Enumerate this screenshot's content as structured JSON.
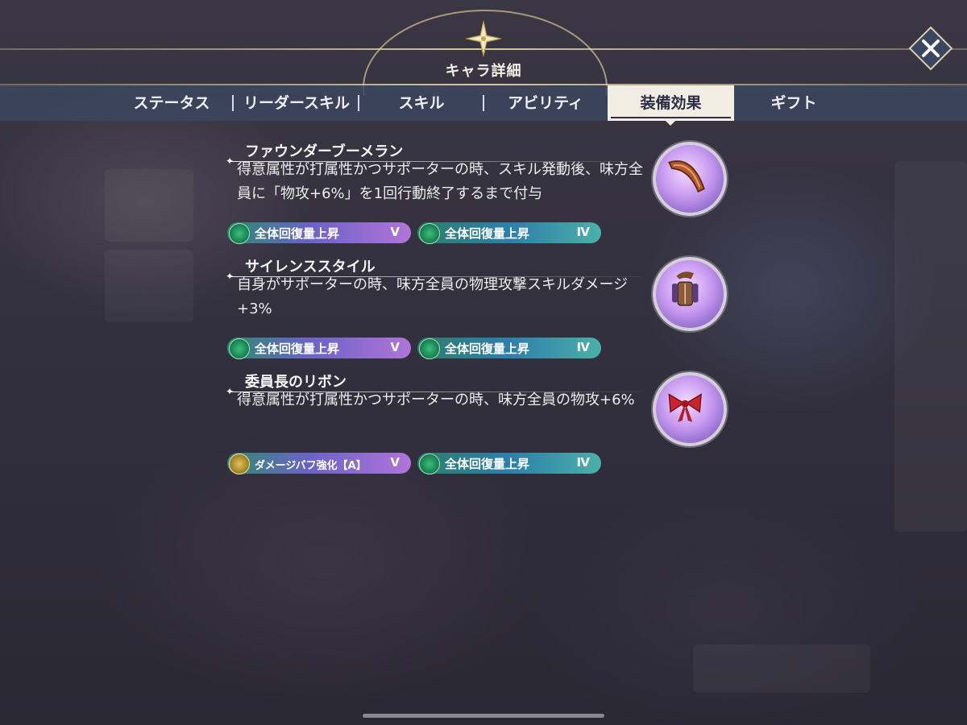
{
  "header": {
    "title": "キャラ詳細",
    "close_symbol": "✕"
  },
  "tabs": [
    {
      "label": "ステータス",
      "active": false
    },
    {
      "label": "リーダースキル",
      "active": false
    },
    {
      "label": "スキル",
      "active": false
    },
    {
      "label": "アビリティ",
      "active": false
    },
    {
      "label": "装備効果",
      "active": true
    },
    {
      "label": "ギフト",
      "active": false
    }
  ],
  "equipment": [
    {
      "name": "ファウンダーブーメラン",
      "description": "得意属性が打属性かつサポーターの時、スキル発動後、味方全員に「物攻+6%」を1回行動終了するまで付与",
      "icon": "boomerang-icon",
      "badges": [
        {
          "label": "全体回復量上昇",
          "grade": "Ⅴ",
          "style": "purple",
          "icon": "heal-heart-icon"
        },
        {
          "label": "全体回復量上昇",
          "grade": "Ⅳ",
          "style": "teal",
          "icon": "heal-heart-icon"
        }
      ]
    },
    {
      "name": "サイレンススタイル",
      "description": "自身がサポーターの時、味方全員の物理攻撃スキルダメージ+3%",
      "icon": "outfit-icon",
      "badges": [
        {
          "label": "全体回復量上昇",
          "grade": "Ⅴ",
          "style": "purple",
          "icon": "heal-heart-icon"
        },
        {
          "label": "全体回復量上昇",
          "grade": "Ⅳ",
          "style": "teal",
          "icon": "heal-heart-icon"
        }
      ]
    },
    {
      "name": "委員長のリボン",
      "description": "得意属性が打属性かつサポーターの時、味方全員の物攻+6%",
      "icon": "ribbon-icon",
      "badges": [
        {
          "label": "ダメージバフ強化【A】",
          "grade": "Ⅴ",
          "style": "gold",
          "icon": "damage-buff-icon"
        },
        {
          "label": "全体回復量上昇",
          "grade": "Ⅳ",
          "style": "teal",
          "icon": "heal-heart-icon"
        }
      ]
    }
  ],
  "colors": {
    "tab_active_bg": "#f1ede3",
    "tab_bar_bg": "#3c465f",
    "header_gold": "#d7c38c"
  }
}
